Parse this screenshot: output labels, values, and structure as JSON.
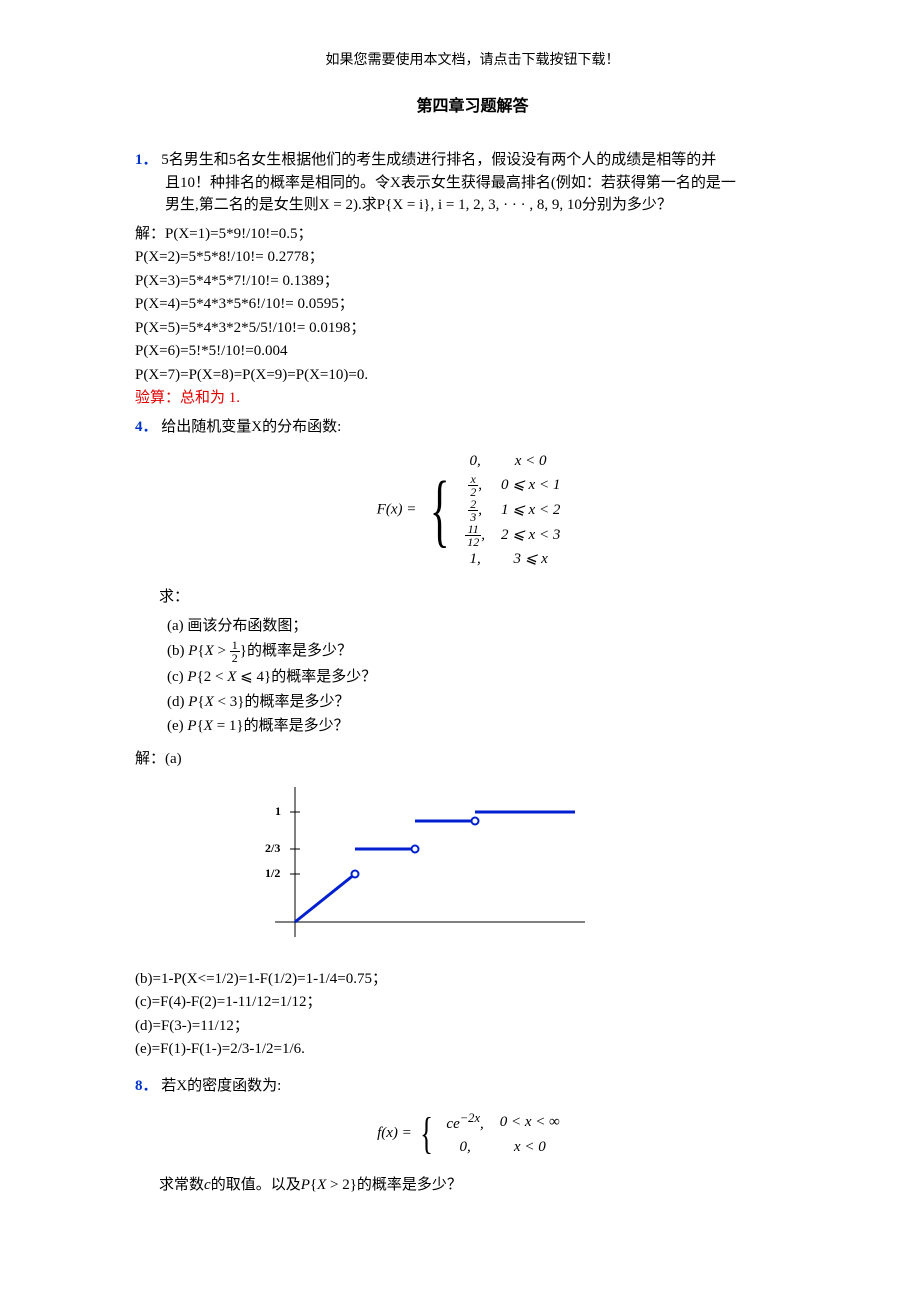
{
  "header_note": "如果您需要使用本文档，请点击下载按钮下载！",
  "title": "第四章习题解答",
  "problem1": {
    "num": "1．",
    "text_line1": "5名男生和5名女生根据他们的考生成绩进行排名，假设没有两个人的成绩是相等的并",
    "text_line2": "且10！种排名的概率是相同的。令X表示女生获得最高排名(例如：若获得第一名的是一",
    "text_line3": "男生,第二名的是女生则X = 2).求P{X = i}, i = 1, 2, 3, · · · , 8, 9, 10分别为多少？"
  },
  "sol1": {
    "lead": "解：P(X=1)=5*9!/10!=0.5；",
    "l2": "P(X=2)=5*5*8!/10!= 0.2778；",
    "l3": "P(X=3)=5*4*5*7!/10!= 0.1389；",
    "l4": "P(X=4)=5*4*3*5*6!/10!= 0.0595；",
    "l5": "P(X=5)=5*4*3*2*5/5!/10!= 0.0198；",
    "l6": "P(X=6)=5!*5!/10!=0.004",
    "l7": "P(X=7)=P(X=8)=P(X=9)=P(X=10)=0.",
    "verify": "验算：总和为 1."
  },
  "problem4": {
    "num": "4．",
    "text": "给出随机变量X的分布函数:",
    "Fx_label": "F(x) = ",
    "rows": [
      {
        "v": "0,",
        "c": "x < 0"
      },
      {
        "v": "x/2,",
        "c": "0 ⩽ x < 1"
      },
      {
        "v": "2/3,",
        "c": "1 ⩽ x < 2"
      },
      {
        "v": "11/12,",
        "c": "2 ⩽ x < 3"
      },
      {
        "v": "1,",
        "c": "3 ⩽ x"
      }
    ],
    "ask": "求：",
    "a": "(a) 画该分布函数图；",
    "b": "(b) P{X > ½}的概率是多少？",
    "c": "(c) P{2 < X ⩽ 4}的概率是多少？",
    "d": "(d) P{X < 3}的概率是多少？",
    "e": "(e) P{X = 1}的概率是多少？"
  },
  "sol4": {
    "lead": "解：(a)",
    "b": "(b)=1-P(X<=1/2)=1-F(1/2)=1-1/4=0.75；",
    "c": "(c)=F(4)-F(2)=1-11/12=1/12；",
    "d": "(d)=F(3-)=11/12；",
    "e": "(e)=F(1)-F(1-)=2/3-1/2=1/6."
  },
  "problem8": {
    "num": "8．",
    "text": "若X的密度函数为:",
    "fx_label": "f(x) = ",
    "rows": [
      {
        "v": "ce⁻²ˣ,",
        "c": "0 < x < ∞"
      },
      {
        "v": "0,",
        "c": "x < 0"
      }
    ],
    "ask": "求常数c的取值。以及P{X > 2}的概率是多少？"
  },
  "chart_data": {
    "type": "step",
    "title": "",
    "xlabel": "",
    "ylabel": "",
    "y_ticks": [
      "1/2",
      "2/3",
      "1"
    ],
    "segments": [
      {
        "kind": "line",
        "from": [
          0,
          0
        ],
        "to": [
          1,
          0.5
        ]
      },
      {
        "kind": "hline",
        "from": [
          1,
          0.6667
        ],
        "to": [
          2,
          0.6667
        ]
      },
      {
        "kind": "hline",
        "from": [
          2,
          0.9167
        ],
        "to": [
          3,
          0.9167
        ]
      },
      {
        "kind": "hline",
        "from": [
          3,
          1
        ],
        "to": [
          4.5,
          1
        ]
      }
    ],
    "open_points": [
      [
        1,
        0.5
      ],
      [
        2,
        0.6667
      ],
      [
        3,
        0.9167
      ]
    ],
    "xlim": [
      0,
      4.5
    ],
    "ylim": [
      0,
      1.05
    ]
  }
}
